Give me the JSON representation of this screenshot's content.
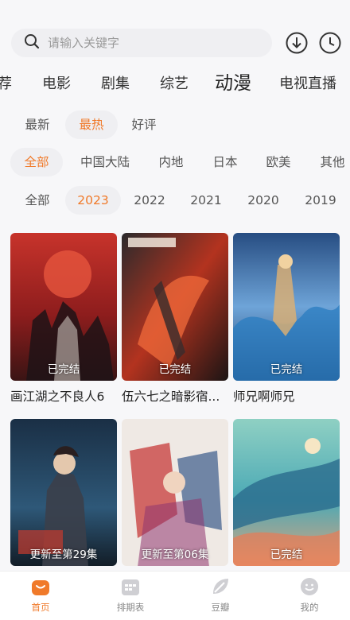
{
  "search": {
    "placeholder": "请输入关键字"
  },
  "header_icons": [
    "download-icon",
    "history-clock-icon"
  ],
  "category_tabs": [
    {
      "label": "荐"
    },
    {
      "label": "电影"
    },
    {
      "label": "剧集"
    },
    {
      "label": "综艺"
    },
    {
      "label": "动漫",
      "active": true
    },
    {
      "label": "电视直播"
    }
  ],
  "sort_filters": [
    {
      "label": "最新"
    },
    {
      "label": "最热",
      "active": true
    },
    {
      "label": "好评"
    }
  ],
  "region_filters": [
    {
      "label": "全部",
      "active": true
    },
    {
      "label": "中国大陆"
    },
    {
      "label": "内地"
    },
    {
      "label": "日本"
    },
    {
      "label": "欧美"
    },
    {
      "label": "其他"
    }
  ],
  "year_filters": [
    {
      "label": "全部"
    },
    {
      "label": "2023",
      "active": true
    },
    {
      "label": "2022"
    },
    {
      "label": "2021"
    },
    {
      "label": "2020"
    },
    {
      "label": "2019"
    }
  ],
  "posters": [
    {
      "title": "画江湖之不良人6",
      "status": "已完结"
    },
    {
      "title": "伍六七之暗影宿...",
      "status": "已完结"
    },
    {
      "title": "师兄啊师兄",
      "status": "已完结"
    },
    {
      "title": "",
      "status": "更新至第29集"
    },
    {
      "title": "",
      "status": "更新至第06集"
    },
    {
      "title": "",
      "status": "已完结"
    }
  ],
  "bottom_nav": [
    {
      "label": "首页",
      "icon": "home-icon",
      "active": true
    },
    {
      "label": "排期表",
      "icon": "calendar-icon"
    },
    {
      "label": "豆瓣",
      "icon": "leaf-icon"
    },
    {
      "label": "我的",
      "icon": "profile-face-icon"
    }
  ],
  "colors": {
    "accent": "#f07a2a",
    "chip_bg": "#efeff2",
    "background": "#f7f7f9"
  }
}
